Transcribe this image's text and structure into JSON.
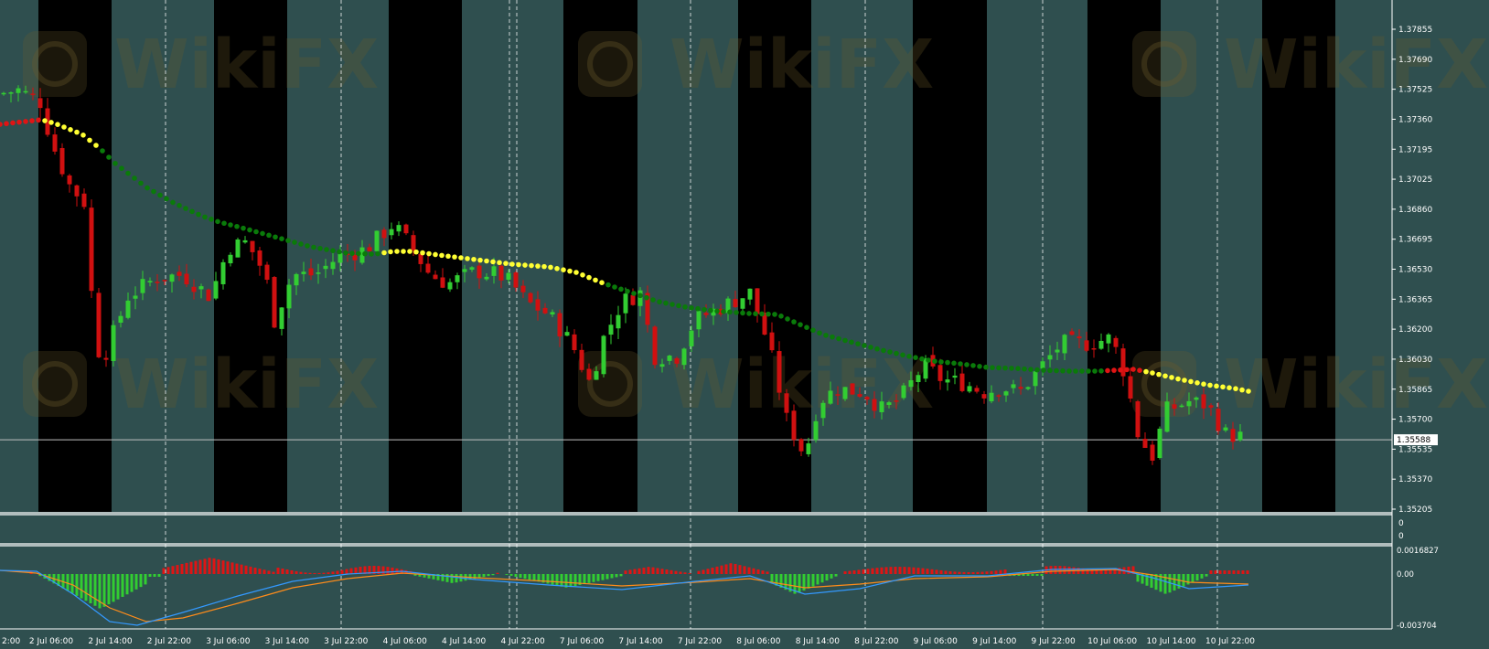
{
  "colors": {
    "background": "#2f4f4f",
    "band_dark": "#000000",
    "bull": "#32cd32",
    "bear": "#d01010",
    "ma_green": "#0a7a0a",
    "ma_yellow": "#ffff33",
    "ma_red": "#e01414",
    "hist_up": "#e01414",
    "hist_down": "#32cd32",
    "signal_orange": "#ff8c1a",
    "signal_blue": "#3399ff",
    "grid": "#ffffff",
    "text": "#ffffff"
  },
  "watermark": {
    "text": "WikiFX"
  },
  "chart_data": [
    {
      "type": "candlestick",
      "title": "",
      "y_axis_ticks": [
        "1.37855",
        "1.37690",
        "1.37525",
        "1.37360",
        "1.37195",
        "1.37025",
        "1.36860",
        "1.36695",
        "1.36530",
        "1.36365",
        "1.36200",
        "1.36030",
        "1.35865",
        "1.35700",
        "1.35535",
        "1.35370",
        "1.35205"
      ],
      "ylim": [
        1.35205,
        1.37855
      ],
      "current_price": {
        "value": 1.35588,
        "label": "1.35588"
      },
      "x_axis_labels": [
        "2 Jul 06:00",
        "2 Jul 14:00",
        "2 Jul 22:00",
        "3 Jul 06:00",
        "3 Jul 14:00",
        "3 Jul 22:00",
        "4 Jul 06:00",
        "4 Jul 14:00",
        "4 Jul 22:00",
        "7 Jul 06:00",
        "7 Jul 14:00",
        "7 Jul 22:00",
        "8 Jul 06:00",
        "8 Jul 14:00",
        "8 Jul 22:00",
        "9 Jul 06:00",
        "9 Jul 14:00",
        "9 Jul 22:00",
        "10 Jul 06:00",
        "10 Jul 14:00",
        "10 Jul 22:00"
      ],
      "x_axis_edge_label": "2:00",
      "moving_average_colors": [
        "red",
        "yellow",
        "green",
        "yellow",
        "green",
        "red",
        "yellow"
      ]
    },
    {
      "type": "indicator",
      "title": "",
      "y_axis_ticks": [
        "0",
        "0"
      ]
    },
    {
      "type": "histogram",
      "title": "",
      "y_axis_ticks": [
        "0.0016827",
        "0.00",
        "-0.003704"
      ],
      "ylim": [
        -0.003704,
        0.0016827
      ],
      "series_colors": [
        "red",
        "green",
        "orange",
        "blue"
      ]
    }
  ]
}
